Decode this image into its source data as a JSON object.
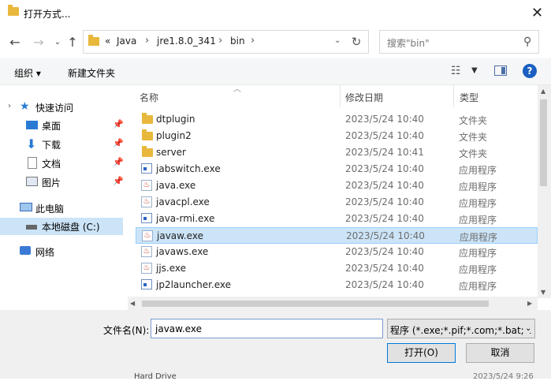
{
  "window": {
    "title": "打开方式..."
  },
  "nav": {
    "breadcrumb": [
      "Java",
      "jre1.8.0_341",
      "bin"
    ],
    "overflow": "«",
    "search_placeholder": "搜索\"bin\""
  },
  "toolbar": {
    "organize": "组织 ▾",
    "new_folder": "新建文件夹"
  },
  "sidebar": {
    "items": [
      {
        "label": "快速访问",
        "icon": "star-icon",
        "pinned": false
      },
      {
        "label": "桌面",
        "icon": "desktop-icon",
        "pinned": true
      },
      {
        "label": "下载",
        "icon": "download-icon",
        "pinned": true
      },
      {
        "label": "文档",
        "icon": "document-icon",
        "pinned": true
      },
      {
        "label": "图片",
        "icon": "picture-icon",
        "pinned": true
      },
      {
        "label": "此电脑",
        "icon": "computer-icon",
        "pinned": false
      },
      {
        "label": "本地磁盘 (C:)",
        "icon": "drive-icon",
        "pinned": false
      },
      {
        "label": "网络",
        "icon": "network-icon",
        "pinned": false
      }
    ]
  },
  "columns": {
    "name": "名称",
    "date": "修改日期",
    "type": "类型"
  },
  "files": [
    {
      "name": "dtplugin",
      "date": "2023/5/24 10:40",
      "type": "文件夹",
      "icon": "folder-icon"
    },
    {
      "name": "plugin2",
      "date": "2023/5/24 10:40",
      "type": "文件夹",
      "icon": "folder-icon"
    },
    {
      "name": "server",
      "date": "2023/5/24 10:41",
      "type": "文件夹",
      "icon": "folder-icon"
    },
    {
      "name": "jabswitch.exe",
      "date": "2023/5/24 10:40",
      "type": "应用程序",
      "icon": "exe-icon"
    },
    {
      "name": "java.exe",
      "date": "2023/5/24 10:40",
      "type": "应用程序",
      "icon": "java-icon"
    },
    {
      "name": "javacpl.exe",
      "date": "2023/5/24 10:40",
      "type": "应用程序",
      "icon": "java-icon"
    },
    {
      "name": "java-rmi.exe",
      "date": "2023/5/24 10:40",
      "type": "应用程序",
      "icon": "exe-icon"
    },
    {
      "name": "javaw.exe",
      "date": "2023/5/24 10:40",
      "type": "应用程序",
      "icon": "java-icon"
    },
    {
      "name": "javaws.exe",
      "date": "2023/5/24 10:40",
      "type": "应用程序",
      "icon": "java-icon"
    },
    {
      "name": "jjs.exe",
      "date": "2023/5/24 10:40",
      "type": "应用程序",
      "icon": "java-icon"
    },
    {
      "name": "jp2launcher.exe",
      "date": "2023/5/24 10:40",
      "type": "应用程序",
      "icon": "exe-icon"
    }
  ],
  "selected_file": "javaw.exe",
  "bottom": {
    "filename_label": "文件名(N):",
    "filename_value": "javaw.exe",
    "filetype_value": "程序 (*.exe;*.pif;*.com;*.bat;*.",
    "open_label": "打开(O)",
    "cancel_label": "取消"
  },
  "background": {
    "item": "Hard Drive",
    "date": "2023/5/24 9:26"
  },
  "colors": {
    "selection": "#cce4f7",
    "accent": "#0078d7",
    "folder": "#e8b83c"
  }
}
